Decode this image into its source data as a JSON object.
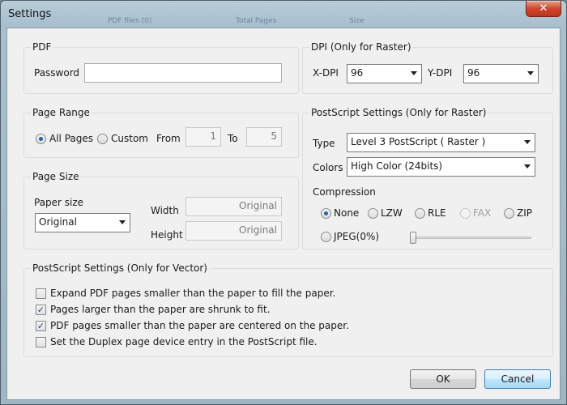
{
  "window": {
    "title": "Settings",
    "close_glyph": "✕",
    "background_tabs": [
      "PDF files (0)",
      "Total Pages",
      "Size"
    ]
  },
  "pdf": {
    "group_label": "PDF",
    "password_label": "Password",
    "password_value": ""
  },
  "dpi": {
    "group_label": "DPI (Only for Raster)",
    "x_label": "X-DPI",
    "x_value": "96",
    "y_label": "Y-DPI",
    "y_value": "96"
  },
  "page_range": {
    "group_label": "Page Range",
    "all_pages_label": "All Pages",
    "all_pages_selected": true,
    "custom_label": "Custom",
    "from_label": "From",
    "from_value": "1",
    "to_label": "To",
    "to_value": "5"
  },
  "page_size": {
    "group_label": "Page Size",
    "paper_size_label": "Paper size",
    "paper_size_value": "Original",
    "width_label": "Width",
    "width_value": "Original",
    "height_label": "Height",
    "height_value": "Original"
  },
  "ps_raster": {
    "group_label": "PostScript Settings (Only for Raster)",
    "type_label": "Type",
    "type_value": "Level 3 PostScript ( Raster )",
    "colors_label": "Colors",
    "colors_value": "High Color (24bits)",
    "compression_label": "Compression",
    "compression_options": [
      {
        "label": "None",
        "checked": true,
        "disabled": false
      },
      {
        "label": "LZW",
        "checked": false,
        "disabled": false
      },
      {
        "label": "RLE",
        "checked": false,
        "disabled": false
      },
      {
        "label": "FAX",
        "checked": false,
        "disabled": true
      },
      {
        "label": "ZIP",
        "checked": false,
        "disabled": false
      },
      {
        "label": "JPEG(0%)",
        "checked": false,
        "disabled": false
      }
    ],
    "jpeg_quality_percent": 0
  },
  "ps_vector": {
    "group_label": "PostScript Settings (Only for Vector)",
    "options": [
      {
        "label": "Expand PDF pages smaller than the paper to fill the  paper.",
        "checked": false
      },
      {
        "label": "Pages larger than the paper are shrunk to fit.",
        "checked": true
      },
      {
        "label": "PDF pages smaller than the paper are  centered  on  the  paper.",
        "checked": true
      },
      {
        "label": "Set the Duplex page device entry in the  PostScript file.",
        "checked": false
      }
    ]
  },
  "buttons": {
    "ok_label": "OK",
    "cancel_label": "Cancel"
  },
  "icons": {
    "check_glyph": "✓"
  }
}
